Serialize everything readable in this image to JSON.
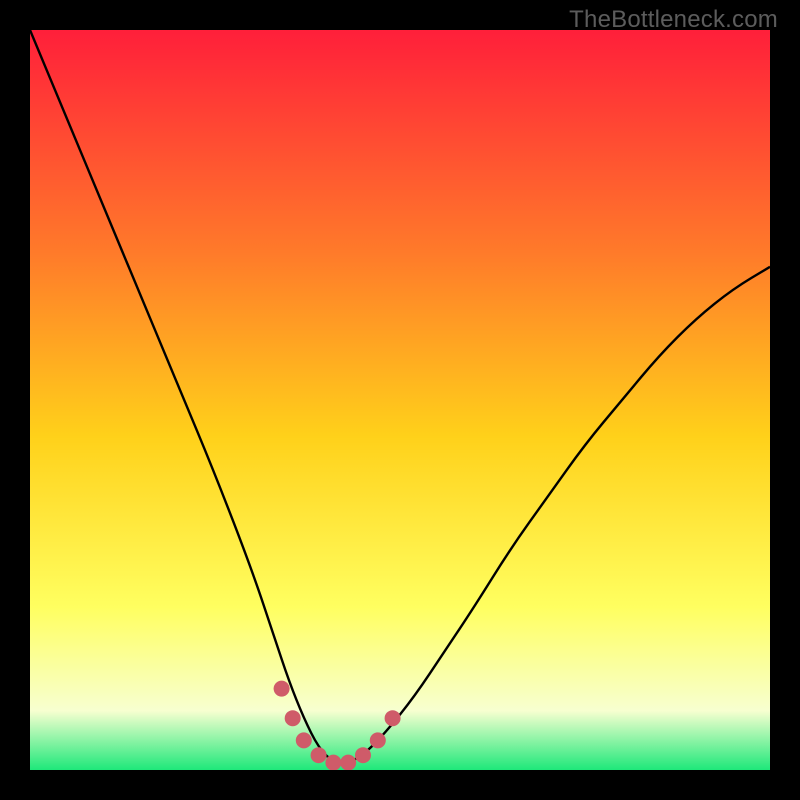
{
  "watermark": "TheBottleneck.com",
  "colors": {
    "frame": "#000000",
    "gradient_top": "#ff1f3a",
    "gradient_mid1": "#ff7a2a",
    "gradient_mid2": "#ffd11a",
    "gradient_mid3": "#ffff60",
    "gradient_mid4": "#f7ffd0",
    "gradient_bottom": "#1ee87a",
    "curve": "#000000",
    "dots": "#cf5b69"
  },
  "chart_data": {
    "type": "line",
    "title": "",
    "xlabel": "",
    "ylabel": "",
    "xlim": [
      0,
      100
    ],
    "ylim": [
      0,
      100
    ],
    "series": [
      {
        "name": "bottleneck-curve",
        "x": [
          0,
          5,
          10,
          15,
          20,
          25,
          30,
          33,
          35,
          37,
          39,
          41,
          43,
          45,
          48,
          52,
          56,
          60,
          65,
          70,
          75,
          80,
          85,
          90,
          95,
          100
        ],
        "values": [
          100,
          88,
          76,
          64,
          52,
          40,
          27,
          18,
          12,
          7,
          3,
          1,
          1,
          2,
          5,
          10,
          16,
          22,
          30,
          37,
          44,
          50,
          56,
          61,
          65,
          68
        ]
      }
    ],
    "dots": {
      "name": "highlight-dots",
      "x": [
        34,
        35.5,
        37,
        39,
        41,
        43,
        45,
        47,
        49
      ],
      "values": [
        11,
        7,
        4,
        2,
        1,
        1,
        2,
        4,
        7
      ]
    }
  }
}
